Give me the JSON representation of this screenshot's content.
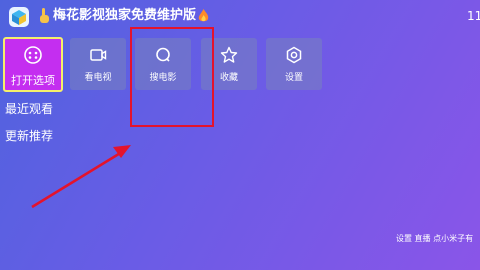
{
  "header": {
    "app_title": "梅花影视独家免费维护版",
    "clock": "11"
  },
  "menu": [
    {
      "label": "打开选项",
      "icon": "menu-dots-icon",
      "selected": true
    },
    {
      "label": "看电视",
      "icon": "tv-icon"
    },
    {
      "label": "搜电影",
      "icon": "search-icon"
    },
    {
      "label": "收藏",
      "icon": "star-icon"
    },
    {
      "label": "设置",
      "icon": "settings-icon"
    }
  ],
  "sections": {
    "recent": "最近观看",
    "updates": "更新推荐"
  },
  "footer": {
    "hint": "设置 直播  点小米子有"
  },
  "colors": {
    "selected_tile": "#c42ef0",
    "focus_border": "#f5f06a",
    "annotation_red": "#e4132c"
  }
}
